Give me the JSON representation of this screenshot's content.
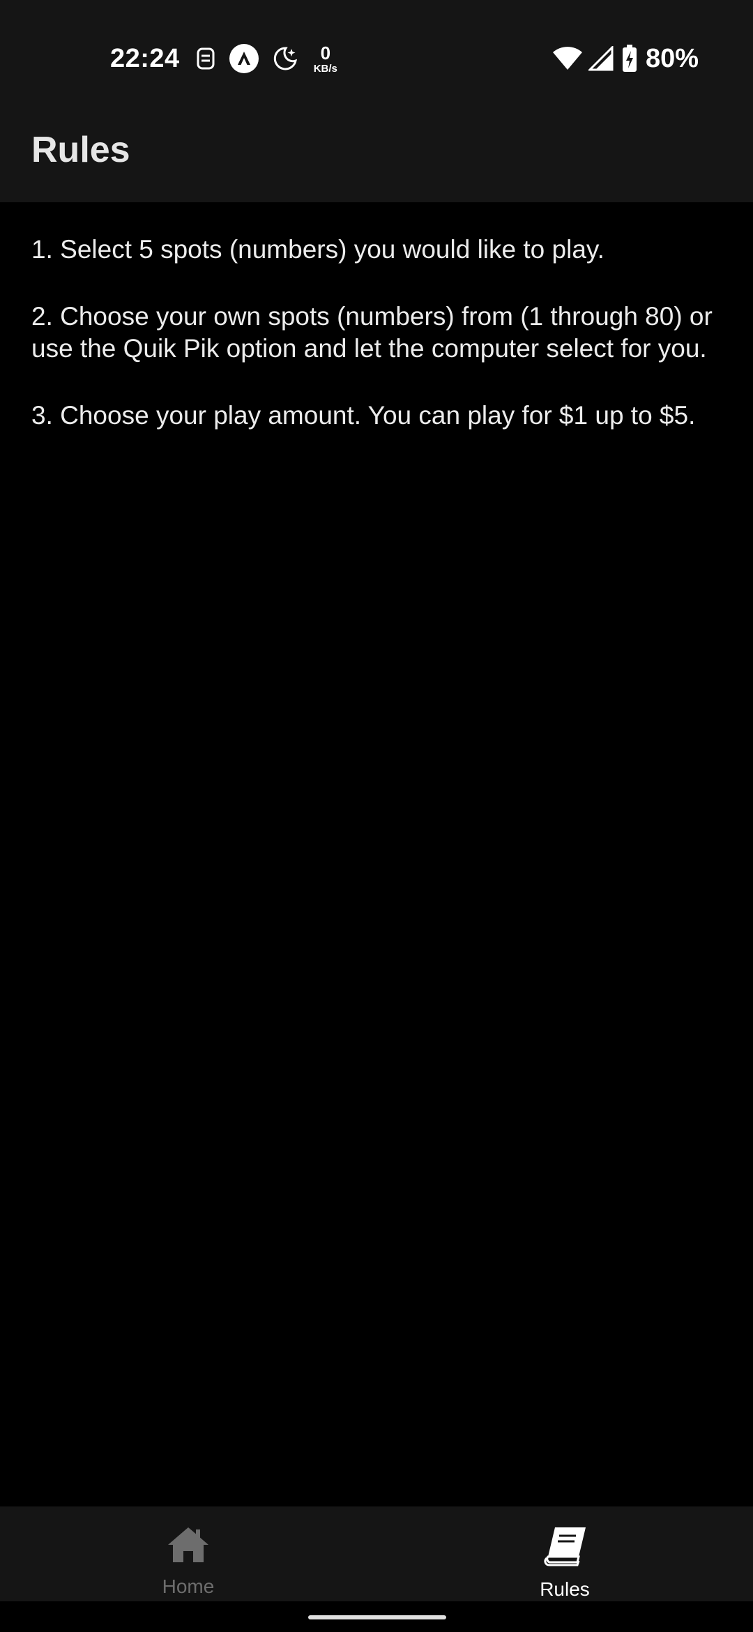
{
  "status_bar": {
    "time": "22:24",
    "net_speed_value": "0",
    "net_speed_unit": "KB/s",
    "battery_percent": "80%",
    "icons": [
      "sim-icon",
      "app-notification-icon",
      "do-not-disturb-icon",
      "wifi-icon",
      "cellular-signal-icon",
      "battery-charging-icon"
    ]
  },
  "app_bar": {
    "title": "Rules"
  },
  "rules": [
    "1. Select 5 spots (numbers) you would like to play.",
    "2. Choose your own spots (numbers) from (1 through 80) or use the Quik Pik option and let the computer select for you.",
    "3. Choose your play amount. You can play for $1 up to $5."
  ],
  "bottom_nav": {
    "items": [
      {
        "label": "Home",
        "icon": "home-icon",
        "active": false
      },
      {
        "label": "Rules",
        "icon": "book-icon",
        "active": true
      }
    ]
  },
  "colors": {
    "background": "#000000",
    "bar_background": "#151515",
    "active": "#ffffff",
    "inactive": "#6d6d6d"
  }
}
